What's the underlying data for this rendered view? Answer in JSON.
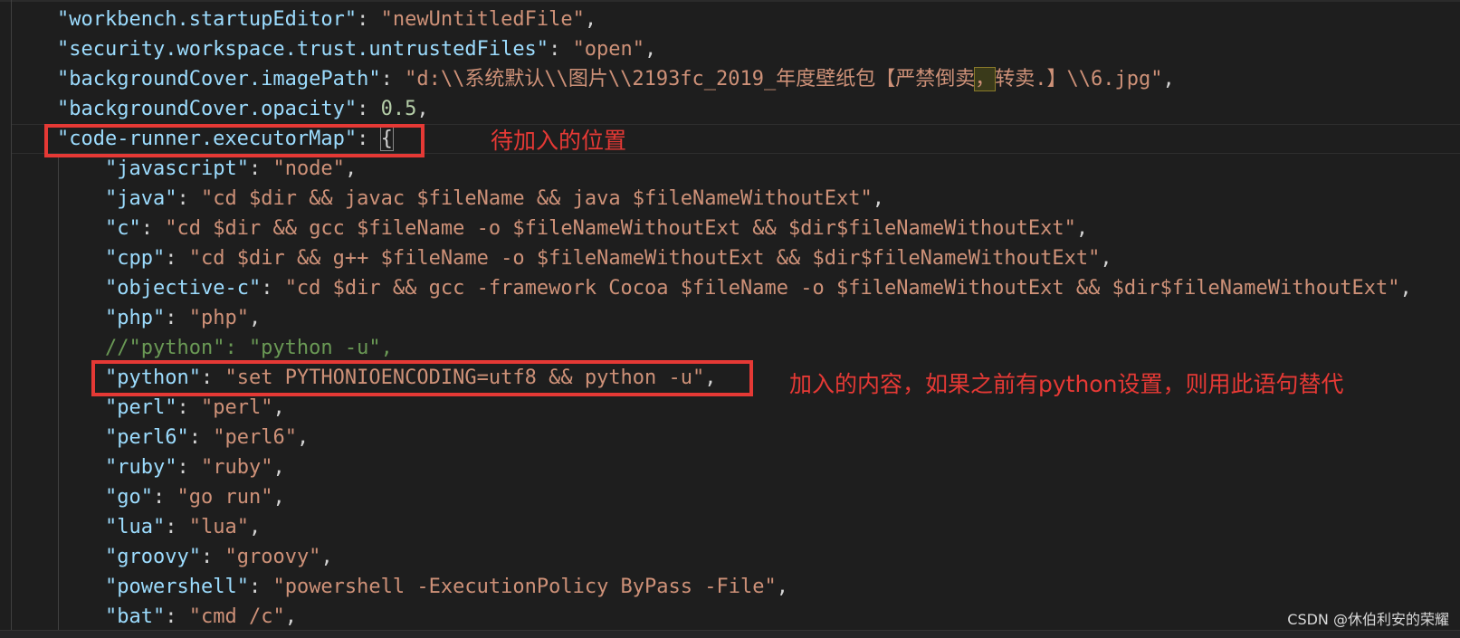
{
  "editor": {
    "lines": [
      {
        "indent": 0,
        "key": "\"workbench.startupEditor\"",
        "sep": ": ",
        "value": "\"newUntitledFile\"",
        "value_type": "string",
        "tail": ","
      },
      {
        "indent": 0,
        "key": "\"security.workspace.trust.untrustedFiles\"",
        "sep": ": ",
        "value": "\"open\"",
        "value_type": "string",
        "tail": ","
      },
      {
        "indent": 0,
        "key": "\"backgroundCover.imagePath\"",
        "sep": ": ",
        "value_a": "\"d:\\\\系统默认\\\\图片\\\\2193fc_2019_年度壁纸包【严禁倒卖",
        "value_hl": "，",
        "value_b": "转卖.】\\\\6.jpg\"",
        "value_type": "string-split",
        "tail": ","
      },
      {
        "indent": 0,
        "key": "\"backgroundCover.opacity\"",
        "sep": ": ",
        "value": "0.5",
        "value_type": "number",
        "tail": ","
      },
      {
        "indent": 0,
        "key": "\"code-runner.executorMap\"",
        "sep": ": ",
        "value": "{",
        "value_type": "bracket",
        "tail": ""
      },
      {
        "indent": 1,
        "key": "\"javascript\"",
        "sep": ": ",
        "value": "\"node\"",
        "value_type": "string",
        "tail": ","
      },
      {
        "indent": 1,
        "key": "\"java\"",
        "sep": ": ",
        "value": "\"cd $dir && javac $fileName && java $fileNameWithoutExt\"",
        "value_type": "string",
        "tail": ","
      },
      {
        "indent": 1,
        "key": "\"c\"",
        "sep": ": ",
        "value": "\"cd $dir && gcc $fileName -o $fileNameWithoutExt && $dir$fileNameWithoutExt\"",
        "value_type": "string",
        "tail": ","
      },
      {
        "indent": 1,
        "key": "\"cpp\"",
        "sep": ": ",
        "value": "\"cd $dir && g++ $fileName -o $fileNameWithoutExt && $dir$fileNameWithoutExt\"",
        "value_type": "string",
        "tail": ","
      },
      {
        "indent": 1,
        "key": "\"objective-c\"",
        "sep": ": ",
        "value": "\"cd $dir && gcc -framework Cocoa $fileName -o $fileNameWithoutExt && $dir$fileNameWithoutExt\"",
        "value_type": "string",
        "tail": ","
      },
      {
        "indent": 1,
        "key": "\"php\"",
        "sep": ": ",
        "value": "\"php\"",
        "value_type": "string",
        "tail": ","
      },
      {
        "indent": 1,
        "comment": "//\"python\": \"python -u\",",
        "value_type": "comment"
      },
      {
        "indent": 1,
        "key": "\"python\"",
        "sep": ": ",
        "value": "\"set PYTHONIOENCODING=utf8 && python -u\"",
        "value_type": "string",
        "tail": ","
      },
      {
        "indent": 1,
        "key": "\"perl\"",
        "sep": ": ",
        "value": "\"perl\"",
        "value_type": "string",
        "tail": ","
      },
      {
        "indent": 1,
        "key": "\"perl6\"",
        "sep": ": ",
        "value": "\"perl6\"",
        "value_type": "string",
        "tail": ","
      },
      {
        "indent": 1,
        "key": "\"ruby\"",
        "sep": ": ",
        "value": "\"ruby\"",
        "value_type": "string",
        "tail": ","
      },
      {
        "indent": 1,
        "key": "\"go\"",
        "sep": ": ",
        "value": "\"go run\"",
        "value_type": "string",
        "tail": ","
      },
      {
        "indent": 1,
        "key": "\"lua\"",
        "sep": ": ",
        "value": "\"lua\"",
        "value_type": "string",
        "tail": ","
      },
      {
        "indent": 1,
        "key": "\"groovy\"",
        "sep": ": ",
        "value": "\"groovy\"",
        "value_type": "string",
        "tail": ","
      },
      {
        "indent": 1,
        "key": "\"powershell\"",
        "sep": ": ",
        "value": "\"powershell -ExecutionPolicy ByPass -File\"",
        "value_type": "string",
        "tail": ","
      },
      {
        "indent": 1,
        "key": "\"bat\"",
        "sep": ": ",
        "value": "\"cmd /c\"",
        "value_type": "string",
        "tail": ","
      }
    ]
  },
  "annotations": {
    "insert_position_label": "待加入的位置",
    "added_content_label": "加入的内容，如果之前有python设置，则用此语句替代"
  },
  "watermark": "CSDN @休伯利安的荣耀",
  "colors": {
    "background": "#1e1e1e",
    "key": "#9cdcfe",
    "string": "#ce9178",
    "number": "#b5cea8",
    "comment": "#6a9955",
    "annotation_red": "#e53935"
  }
}
